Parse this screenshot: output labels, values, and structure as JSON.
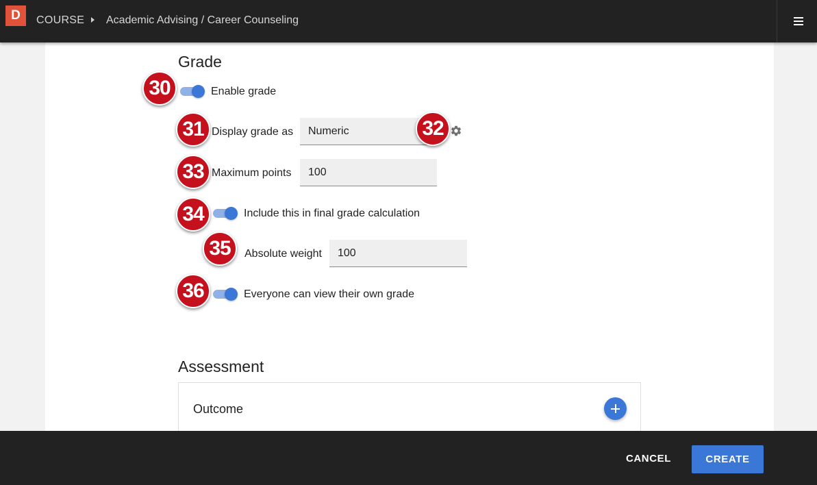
{
  "header": {
    "logo_letter": "D",
    "breadcrumb": [
      "COURSE",
      "Academic Advising / Career Counseling"
    ]
  },
  "grade_section": {
    "title": "Grade",
    "enable_grade": {
      "badge": "30",
      "label": "Enable grade",
      "on": true
    },
    "display_grade_as": {
      "badge": "31",
      "label": "Display grade as",
      "value": "Numeric"
    },
    "settings": {
      "badge": "32",
      "icon": "gear-icon"
    },
    "maximum_points": {
      "badge": "33",
      "label": "Maximum points",
      "value": "100"
    },
    "include_final": {
      "badge": "34",
      "label": "Include this in final grade calculation",
      "on": true
    },
    "absolute_weight": {
      "badge": "35",
      "label": "Absolute weight",
      "value": "100"
    },
    "view_own_grade": {
      "badge": "36",
      "label": "Everyone can view their own grade",
      "on": true
    }
  },
  "assessment_section": {
    "title": "Assessment",
    "outcome_label": "Outcome",
    "add_icon": "plus-icon"
  },
  "footer": {
    "cancel_label": "CANCEL",
    "create_label": "CREATE"
  },
  "colors": {
    "accent": "#3b77d6",
    "badge": "#c4111d",
    "logo": "#e0533a",
    "bar": "#222223"
  }
}
